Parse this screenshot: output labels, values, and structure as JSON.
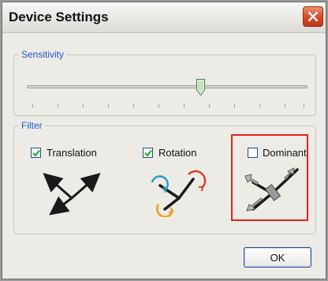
{
  "window": {
    "title": "Device Settings"
  },
  "sensitivity": {
    "label": "Sensitivity",
    "value_fraction": 0.55,
    "tick_count": 12
  },
  "filter": {
    "label": "Filter",
    "options": [
      {
        "label": "Translation",
        "checked": true,
        "icon": "translation-axes-icon"
      },
      {
        "label": "Rotation",
        "checked": true,
        "icon": "rotation-axes-icon"
      },
      {
        "label": "Dominant",
        "checked": false,
        "icon": "dominant-axis-icon",
        "highlighted": true
      }
    ]
  },
  "buttons": {
    "ok_label": "OK"
  },
  "colors": {
    "group_label": "#1f59c9",
    "highlight_border": "#e02418",
    "close_button": "#d44a23"
  }
}
